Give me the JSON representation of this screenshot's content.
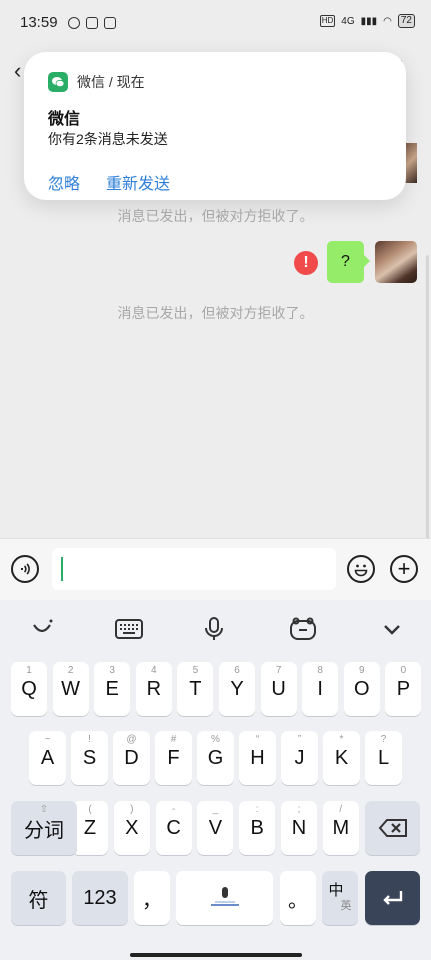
{
  "status_bar": {
    "time": "13:59",
    "network": "4G",
    "battery": "72",
    "hd": "HD"
  },
  "notification": {
    "source": "微信 / 现在",
    "title": "微信",
    "body": "你有2条消息未发送",
    "ignore_label": "忽略",
    "resend_label": "重新发送"
  },
  "chat": {
    "system_message_1": "消息已发出，但被对方拒收了。",
    "system_message_2": "消息已发出，但被对方拒收了。",
    "error_mark": "!",
    "sent_message": "?"
  },
  "input": {
    "value": ""
  },
  "keyboard": {
    "row1": [
      {
        "key": "Q",
        "hint": "1"
      },
      {
        "key": "W",
        "hint": "2"
      },
      {
        "key": "E",
        "hint": "3"
      },
      {
        "key": "R",
        "hint": "4"
      },
      {
        "key": "T",
        "hint": "5"
      },
      {
        "key": "Y",
        "hint": "6"
      },
      {
        "key": "U",
        "hint": "7"
      },
      {
        "key": "I",
        "hint": "8"
      },
      {
        "key": "O",
        "hint": "9"
      },
      {
        "key": "P",
        "hint": "0"
      }
    ],
    "row2": [
      {
        "key": "A",
        "hint": "~"
      },
      {
        "key": "S",
        "hint": "!"
      },
      {
        "key": "D",
        "hint": "@"
      },
      {
        "key": "F",
        "hint": "#"
      },
      {
        "key": "G",
        "hint": "%"
      },
      {
        "key": "H",
        "hint": "“"
      },
      {
        "key": "J",
        "hint": "”"
      },
      {
        "key": "K",
        "hint": "*"
      },
      {
        "key": "L",
        "hint": "?"
      }
    ],
    "row3": [
      {
        "key": "Z",
        "hint": "("
      },
      {
        "key": "X",
        "hint": ")"
      },
      {
        "key": "C",
        "hint": "-"
      },
      {
        "key": "V",
        "hint": "_"
      },
      {
        "key": "B",
        "hint": ":"
      },
      {
        "key": "N",
        "hint": ";"
      },
      {
        "key": "M",
        "hint": "/"
      }
    ],
    "segment_label": "分词",
    "symbol_label": "符",
    "numeric_label": "123",
    "comma": "，",
    "period": "。",
    "lang_main": "中",
    "lang_sub": "英"
  }
}
